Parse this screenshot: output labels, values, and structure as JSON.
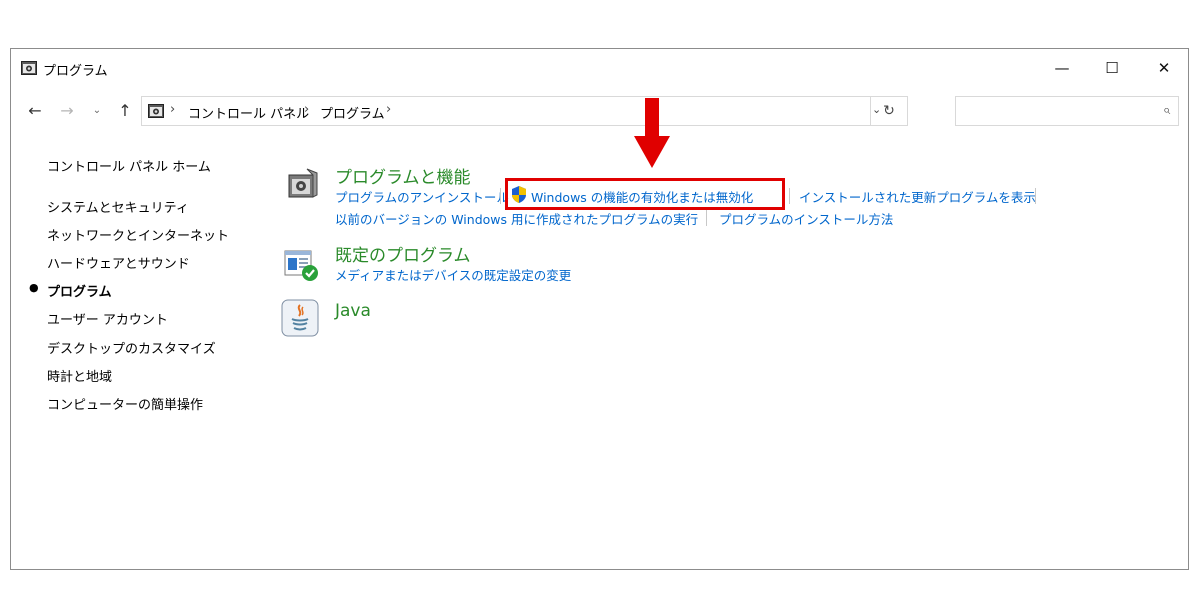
{
  "window": {
    "title": "プログラム",
    "controls": {
      "minimize": "—",
      "maximize": "☐",
      "close": "✕"
    }
  },
  "navigation": {
    "back": "←",
    "forward": "→",
    "recent": "⌄",
    "up": "↑",
    "breadcrumbs": [
      "コントロール パネル",
      "プログラム"
    ],
    "separator": "›",
    "dropdown": "⌄",
    "refresh": "↻",
    "search_placeholder": ""
  },
  "sidebar": {
    "items": [
      {
        "label": "コントロール パネル ホーム",
        "current": false
      },
      {
        "label": "システムとセキュリティ",
        "current": false
      },
      {
        "label": "ネットワークとインターネット",
        "current": false
      },
      {
        "label": "ハードウェアとサウンド",
        "current": false
      },
      {
        "label": "プログラム",
        "current": true
      },
      {
        "label": "ユーザー アカウント",
        "current": false
      },
      {
        "label": "デスクトップのカスタマイズ",
        "current": false
      },
      {
        "label": "時計と地域",
        "current": false
      },
      {
        "label": "コンピューターの簡単操作",
        "current": false
      }
    ]
  },
  "categories": [
    {
      "title": "プログラムと機能",
      "icon": "programs-features-icon",
      "links": [
        "プログラムのアンインストール",
        "Windows の機能の有効化または無効化",
        "インストールされた更新プログラムを表示",
        "以前のバージョンの Windows 用に作成されたプログラムの実行",
        "プログラムのインストール方法"
      ]
    },
    {
      "title": "既定のプログラム",
      "icon": "default-programs-icon",
      "links": [
        "メディアまたはデバイスの既定設定の変更"
      ]
    },
    {
      "title": "Java",
      "icon": "java-icon",
      "links": []
    }
  ],
  "annotation": {
    "color": "#e00000"
  },
  "colors": {
    "link": "#0066cc",
    "category_title": "#2a8a2a",
    "highlight": "#e00000"
  }
}
